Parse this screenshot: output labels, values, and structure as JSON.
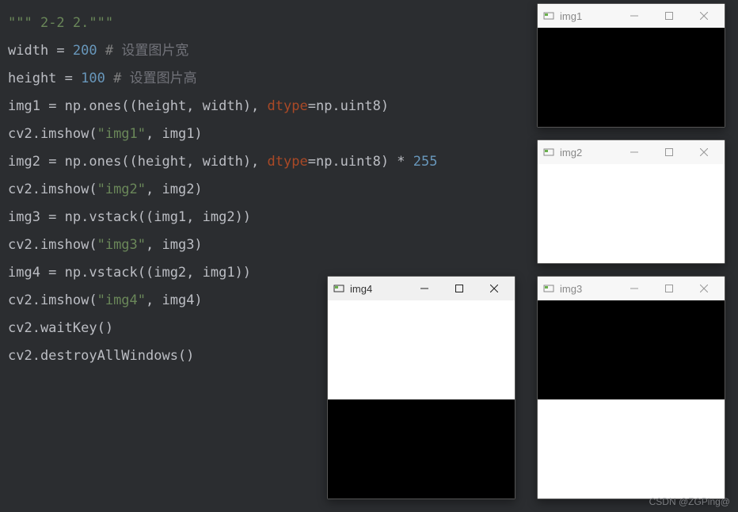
{
  "code": {
    "l1_str1": "\"\"\"",
    "l1_str2": " 2-2 2.\"\"\"",
    "l2_ident": "width",
    "l2_eq": " = ",
    "l2_num": "200",
    "l2_hash": " # ",
    "l2_comment": "设置图片宽",
    "l3_ident": "height",
    "l3_eq": " = ",
    "l3_num": "100",
    "l3_hash": " # ",
    "l3_comment": "设置图片高",
    "l4_a": "img1",
    "l4_b": " = np.ones((height, width), ",
    "l4_param": "dtype",
    "l4_c": "=np.uint8)",
    "l5_a": "cv2.imshow(",
    "l5_str": "\"img1\"",
    "l5_b": ", img1)",
    "l6_a": "img2",
    "l6_b": " = np.ones((height, width), ",
    "l6_param": "dtype",
    "l6_c": "=np.uint8) * ",
    "l6_num": "255",
    "l7_a": "cv2.imshow(",
    "l7_str": "\"img2\"",
    "l7_b": ", img2)",
    "l8": "img3 = np.vstack((img1, img2))",
    "l9_a": "cv2.imshow(",
    "l9_str": "\"img3\"",
    "l9_b": ", img3)",
    "l10": "img4 = np.vstack((img2, img1))",
    "l11_a": "cv2.imshow(",
    "l11_str": "\"img4\"",
    "l11_b": ", img4)",
    "l12": "cv2.waitKey()",
    "l13": "cv2.destroyAllWindows()"
  },
  "windows": {
    "img1": {
      "title": "img1"
    },
    "img2": {
      "title": "img2"
    },
    "img3": {
      "title": "img3"
    },
    "img4": {
      "title": "img4"
    }
  },
  "watermark": "CSDN @ZGPing@"
}
